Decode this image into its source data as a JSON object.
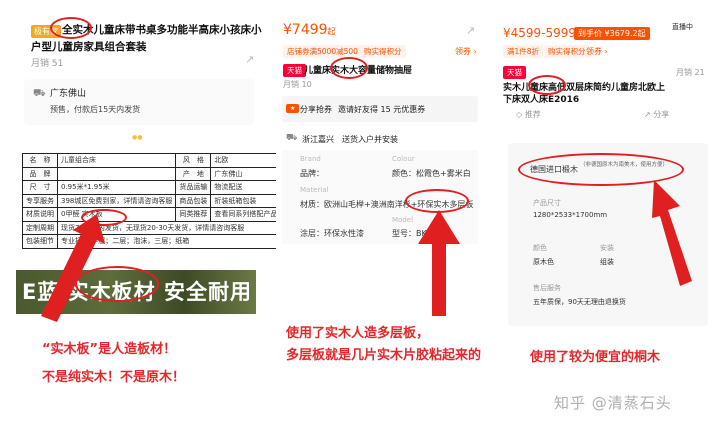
{
  "panel1": {
    "badge": "极有家",
    "title_line1": "全实木儿童床带书桌多功能半高床小孩床小",
    "title_line2": "户型儿童房家具组合套装",
    "sales": "月销 51",
    "ship_from": "广东佛山",
    "presale": "预售，付款后15天内发货",
    "dots": "●●",
    "table": [
      [
        "名　称",
        "儿童组合床",
        "风　格",
        "北欧"
      ],
      [
        "品　牌",
        "",
        "产　地",
        "广东佛山"
      ],
      [
        "尺　寸",
        "0.95米*1.95米",
        "货品运输",
        "物流配送"
      ],
      [
        "专享服务",
        "398城区免费到家，详情请咨询客服",
        "商品包装",
        "折装纸箱包装"
      ],
      [
        "材质说明",
        "0甲醛 实木板",
        "同类推荐",
        "查看同系列搭配产品"
      ],
      [
        "定制周期",
        "现货7-15天内发货，无现货20-30天发货，详情请咨询客服",
        "",
        ""
      ],
      [
        "包装细节",
        "专业打包 —层；二层；泡沫，三层；纸箱",
        "",
        ""
      ]
    ],
    "banner": "E蓝 实木板材 安全耐用",
    "caption_line1": "“实木板”是人造板材！",
    "caption_line2": "不是纯实木！不是原木！"
  },
  "panel2": {
    "price": "¥7499",
    "price_suffix": "起",
    "coupon1": "店铺券满5000减500",
    "coupon2": "购实得积分",
    "coupon_action": "领券 ›",
    "tag": "天猫",
    "title": "儿童床实木大容量储物抽屉",
    "sales": "月销 10",
    "share": "分享抢券",
    "share_desc": "邀请好友得 15 元优惠券",
    "ship_from": "浙江嘉兴",
    "ship_desc": "送货入户并安装",
    "brand_label": "Brand",
    "brand_value": "品牌：",
    "colour_label": "Colour",
    "colour_value": "颜色：松霞色+雾米白",
    "material_label": "Material",
    "material_value": "材质：欧洲山毛榉+澳洲南洋杉+",
    "material_highlight": "环保实木多层板",
    "coat_value": "涂层：环保水性漆",
    "model_label": "Model",
    "model_value": "型号：BK-A",
    "caption_line1": "使用了实木人造多层板，",
    "caption_line2": "多层板就是几片实木片胶粘起来的"
  },
  "panel3": {
    "price": "¥4599-5999",
    "price_tag": "到手价 ¥3679.2起",
    "live": "直播中",
    "coupon1": "满1件8折",
    "coupon2": "购实得积分",
    "coupon3": "领券 ›",
    "tag": "天猫",
    "sales": "月销 21",
    "title_line1": "实木儿童床高低双层床简约儿童房北欧上",
    "title_line2": "下床双人床E2016",
    "action1": "推荐",
    "action2": "分享",
    "spec_material": "德国进口椴木",
    "spec_material_note": "（非德国原木为南美木，使用方便）",
    "spec_size_label": "产品尺寸",
    "spec_size": "1280*2533*1700mm",
    "spec_color_label": "颜色",
    "spec_color": "原木色",
    "spec_install_label": "安装",
    "spec_install": "组装",
    "spec_service_label": "售后服务",
    "spec_service": "五年质保，90天无理由退换货",
    "caption": "使用了较为便宜的桐木"
  },
  "watermark": "知乎 @清蒸石头"
}
